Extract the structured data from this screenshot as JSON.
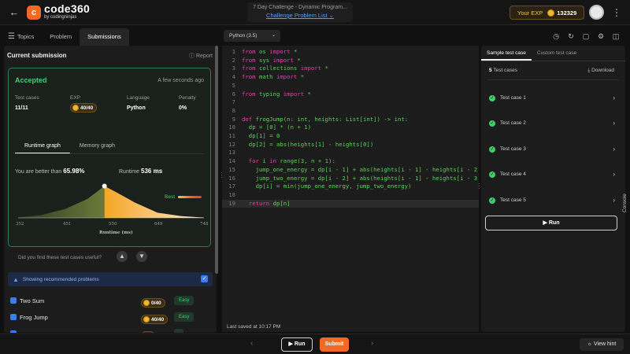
{
  "header": {
    "logo_mark": "c",
    "logo_name": "code360",
    "logo_sub": "by codingninjas",
    "challenge_title": "7 Day Challenge - Dynamic Program...",
    "challenge_link": "Challenge Problem List",
    "exp_label": "Your EXP",
    "exp_value": "132329"
  },
  "left_tabs": [
    "Topics",
    "Problem",
    "Submissions"
  ],
  "submission": {
    "title": "Current submission",
    "report": "Report",
    "status": "Accepted",
    "time_ago": "A few seconds ago",
    "stats": [
      {
        "label": "Test cases",
        "value": "11/11"
      },
      {
        "label": "EXP",
        "value": "40/40"
      },
      {
        "label": "Language",
        "value": "Python"
      },
      {
        "label": "Penalty",
        "value": "0%"
      }
    ],
    "graph_tabs": [
      "Runtime graph",
      "Memory graph"
    ],
    "better_text": "You are better than",
    "better_value": "65.98%",
    "runtime_text": "Runtime",
    "runtime_value": "536 ms",
    "best_label": "Best",
    "useful_question": "Did you find these test cases useful?"
  },
  "chart_data": {
    "type": "area",
    "xlabel": "Runtime (ms)",
    "x_ticks": [
      "352",
      "451",
      "550",
      "649",
      "748"
    ],
    "xlim": [
      352,
      748
    ],
    "marker_x": 536,
    "curve": [
      [
        352,
        0.02
      ],
      [
        400,
        0.08
      ],
      [
        451,
        0.25
      ],
      [
        500,
        0.55
      ],
      [
        536,
        0.92
      ],
      [
        560,
        0.75
      ],
      [
        600,
        0.45
      ],
      [
        649,
        0.15
      ],
      [
        700,
        0.05
      ],
      [
        748,
        0.01
      ]
    ],
    "colors": {
      "left": "#4b6b3a",
      "right_start": "#f5a623",
      "right_end": "#fde8d0"
    }
  },
  "recommended": {
    "label": "Showing recommended problems",
    "problems": [
      {
        "name": "Two Sum",
        "exp": "0/40",
        "difficulty": "Easy"
      },
      {
        "name": "Frog Jump",
        "exp": "40/40",
        "difficulty": "Easy"
      },
      {
        "name": "",
        "exp": "",
        "difficulty": ""
      }
    ]
  },
  "editor": {
    "language": "Python (3.5)",
    "last_saved": "Last saved at 10:17 PM",
    "lines": [
      {
        "n": "1",
        "code": "from os import *"
      },
      {
        "n": "2",
        "code": "from sys import *"
      },
      {
        "n": "3",
        "code": "from collections import *"
      },
      {
        "n": "4",
        "code": "from math import *"
      },
      {
        "n": "5",
        "code": ""
      },
      {
        "n": "6",
        "code": "from typing import *"
      },
      {
        "n": "7",
        "code": ""
      },
      {
        "n": "8",
        "code": ""
      },
      {
        "n": "9",
        "code": "def frogJump(n: int, heights: List[int]) -> int:"
      },
      {
        "n": "10",
        "code": "  dp = [0] * (n + 1)"
      },
      {
        "n": "11",
        "code": "  dp[1] = 0"
      },
      {
        "n": "12",
        "code": "  dp[2] = abs(heights[1] - heights[0])"
      },
      {
        "n": "13",
        "code": ""
      },
      {
        "n": "14",
        "code": "  for i in range(3, n + 1):"
      },
      {
        "n": "15",
        "code": "    jump_one_energy = dp[i - 1] + abs(heights[i - 1] - heights[i - 2"
      },
      {
        "n": "16",
        "code": "    jump_two_energy = dp[i - 2] + abs(heights[i - 1] - heights[i - 3"
      },
      {
        "n": "17",
        "code": "    dp[i] = min(jump_one_energy, jump_two_energy)"
      },
      {
        "n": "18",
        "code": ""
      },
      {
        "n": "19",
        "code": "  return dp[n]"
      }
    ]
  },
  "right_panel": {
    "tabs": [
      "Sample test case",
      "Custom test case"
    ],
    "count": "5",
    "count_label": "Test cases",
    "download": "Download",
    "cases": [
      "Test case 1",
      "Test case 2",
      "Test case 3",
      "Test case 4",
      "Test case 5"
    ],
    "run_label": "Run",
    "console_label": "Console"
  },
  "bottom": {
    "run_label": "Run",
    "submit_label": "Submit",
    "hint_label": "View hint"
  }
}
